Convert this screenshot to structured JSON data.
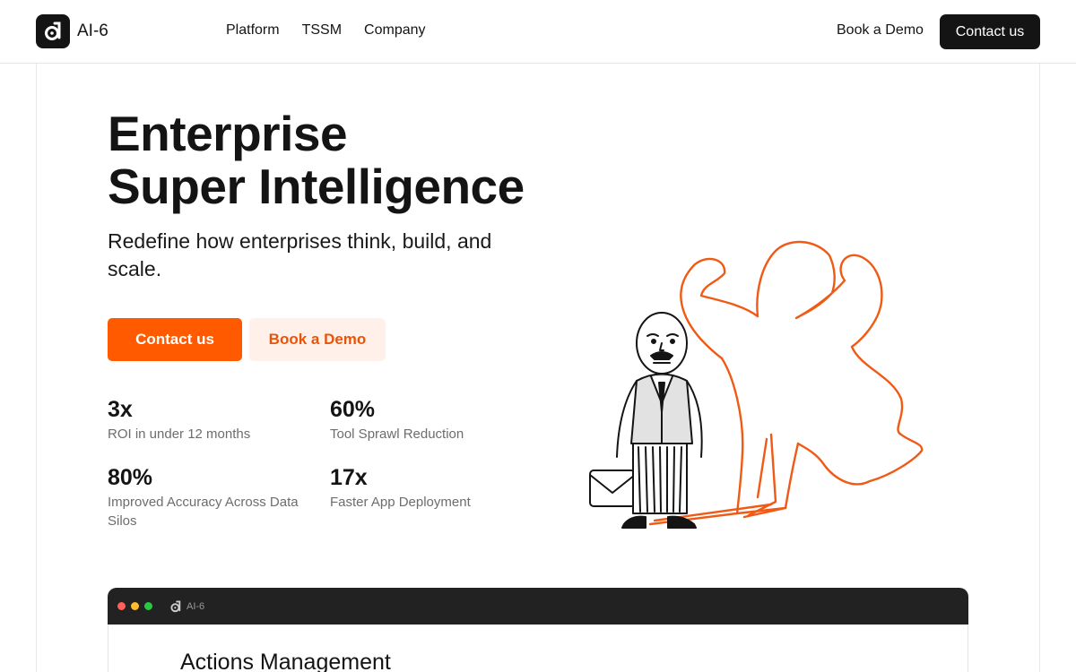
{
  "brand": {
    "name": "AI-6"
  },
  "nav": {
    "items": [
      "Platform",
      "TSSM",
      "Company"
    ]
  },
  "header": {
    "book_demo": "Book a Demo",
    "contact": "Contact us"
  },
  "hero": {
    "title_line1": "Enterprise",
    "title_line2": "Super Intelligence",
    "subtitle": "Redefine how enterprises think, build, and scale.",
    "cta_primary": "Contact us",
    "cta_secondary": "Book a Demo"
  },
  "stats": [
    {
      "value": "3x",
      "label": "ROI in under 12 months"
    },
    {
      "value": "60%",
      "label": "Tool Sprawl Reduction"
    },
    {
      "value": "80%",
      "label": "Improved Accuracy Across Data Silos"
    },
    {
      "value": "17x",
      "label": "Faster App Deployment"
    }
  ],
  "app_window": {
    "brand": "AI-6",
    "heading": "Actions Management"
  },
  "colors": {
    "accent": "#ff5a00",
    "accent_soft": "#fff1e9",
    "dark": "#141414"
  },
  "icons": [
    "ai6-logo-icon",
    "businessman-illustration",
    "superhero-shadow-illustration"
  ]
}
